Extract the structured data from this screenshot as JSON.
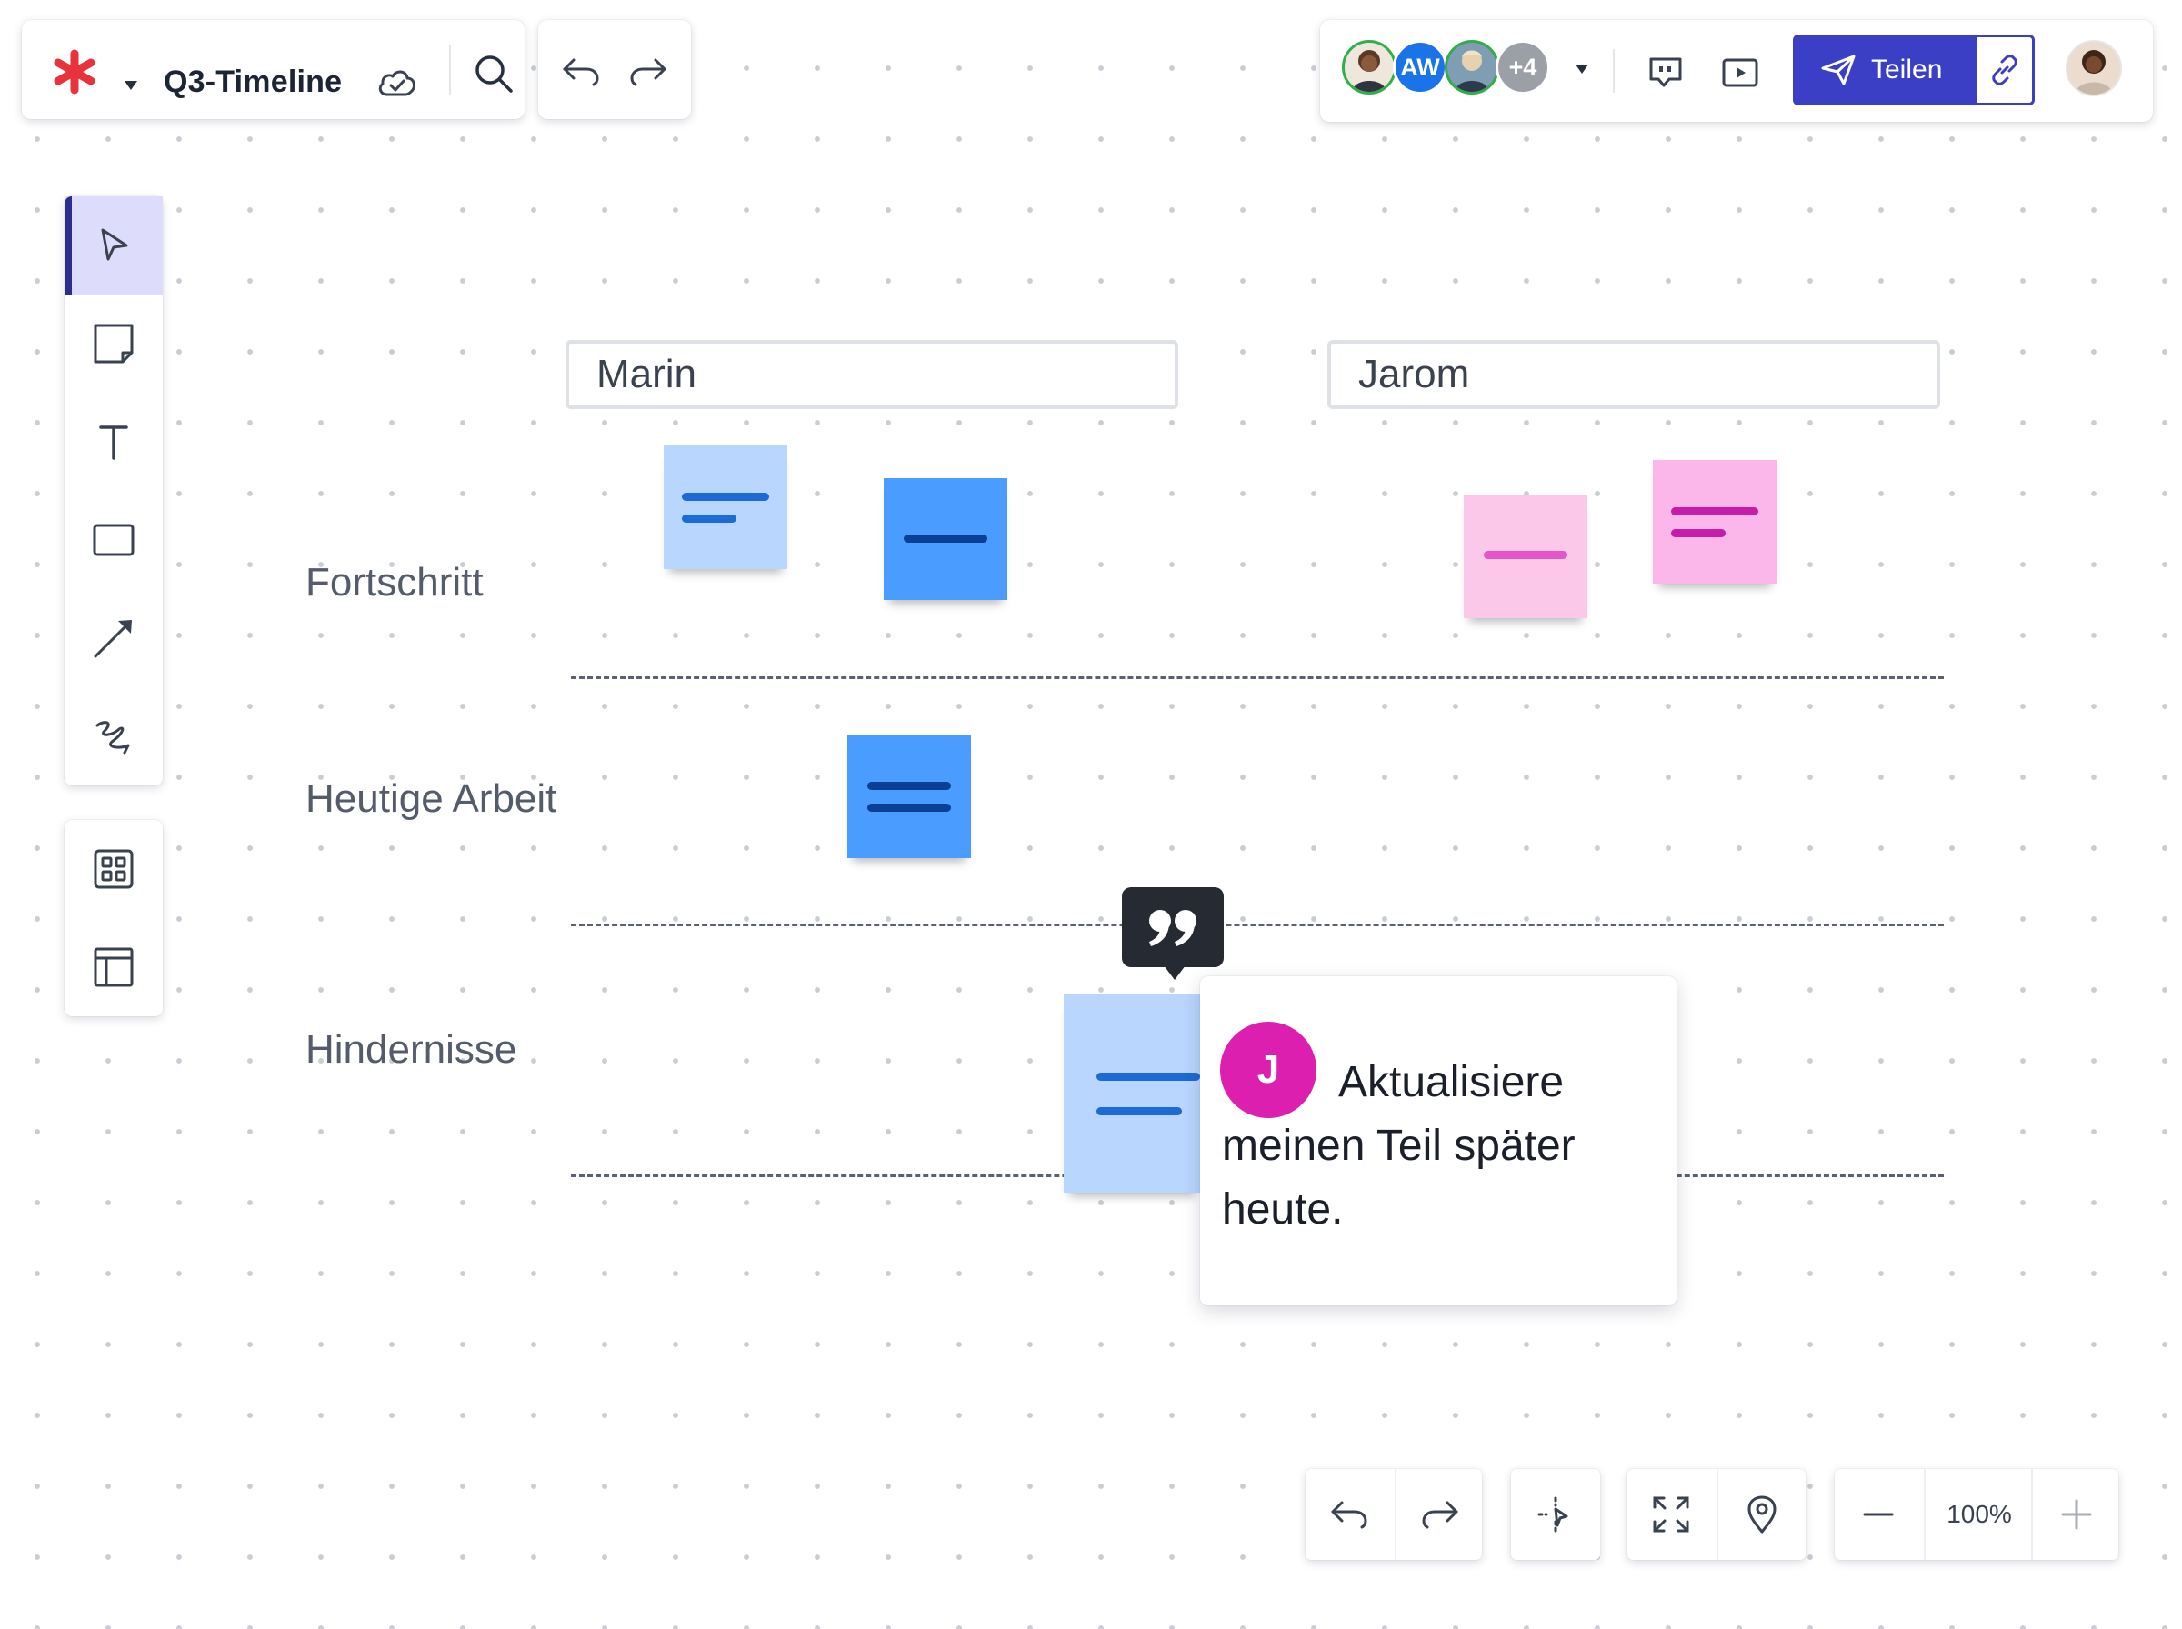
{
  "document": {
    "title": "Q3-Timeline"
  },
  "collaborators": {
    "initials_aw": "AW",
    "more_count": "+4"
  },
  "share": {
    "label": "Teilen"
  },
  "board": {
    "lanes": [
      "Marin",
      "Jarom"
    ],
    "rows": [
      "Fortschritt",
      "Heutige Arbeit",
      "Hindernisse"
    ]
  },
  "comment": {
    "author_initial": "J",
    "text": "Aktualisiere meinen Teil später heute."
  },
  "zoom": {
    "level": "100%"
  },
  "colors": {
    "accent": "#3a3fc6",
    "logo": "#e8323c",
    "comment_avatar": "#dc1fae",
    "sticky_light_blue": "#b9d6ff",
    "sticky_blue": "#4b9cff",
    "sticky_pink": "#fcc8ea"
  },
  "icons": {
    "toolbar": [
      "select-pointer-icon",
      "sticky-note-icon",
      "text-icon",
      "rectangle-icon",
      "arrow-line-icon",
      "freehand-pen-icon"
    ],
    "toolbar_secondary": [
      "templates-grid-icon",
      "layout-frame-icon"
    ]
  }
}
